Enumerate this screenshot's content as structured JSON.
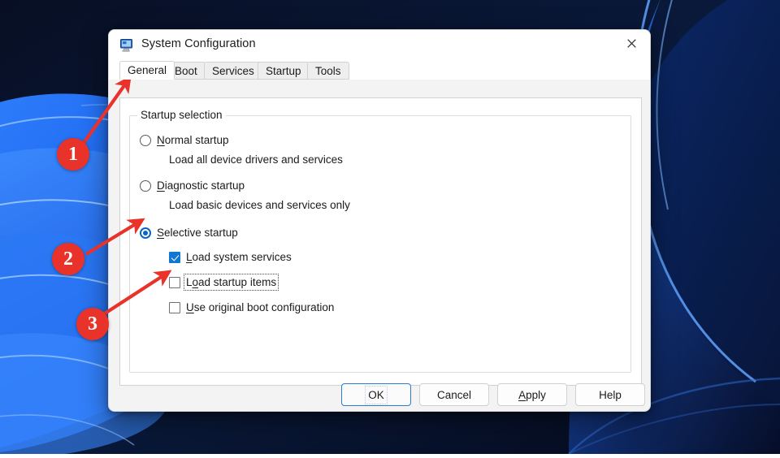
{
  "window": {
    "title": "System Configuration",
    "icon": "computer-icon",
    "close_label": "✕"
  },
  "tabs": [
    {
      "label": "General",
      "active": true
    },
    {
      "label": "Boot",
      "active": false
    },
    {
      "label": "Services",
      "active": false
    },
    {
      "label": "Startup",
      "active": false
    },
    {
      "label": "Tools",
      "active": false
    }
  ],
  "groupbox": {
    "legend": "Startup selection"
  },
  "radios": [
    {
      "label_pre": "",
      "accel": "N",
      "label_post": "ormal startup",
      "checked": false,
      "description": "Load all device drivers and services"
    },
    {
      "label_pre": "",
      "accel": "D",
      "label_post": "iagnostic startup",
      "checked": false,
      "description": "Load basic devices and services only"
    },
    {
      "label_pre": "",
      "accel": "S",
      "label_post": "elective startup",
      "checked": true,
      "description": ""
    }
  ],
  "checkboxes": [
    {
      "label_pre": "",
      "accel": "L",
      "label_post": "oad system services",
      "checked": true,
      "focused": false
    },
    {
      "label_pre": "L",
      "accel": "o",
      "label_post": "ad startup items",
      "checked": false,
      "focused": true
    },
    {
      "label_pre": "",
      "accel": "U",
      "label_post": "se original boot configuration",
      "checked": false,
      "focused": false
    }
  ],
  "buttons": [
    {
      "label_pre": "OK",
      "accel": "",
      "label_post": "",
      "default": true
    },
    {
      "label_pre": "Cancel",
      "accel": "",
      "label_post": "",
      "default": false
    },
    {
      "label_pre": "",
      "accel": "A",
      "label_post": "pply",
      "default": false
    },
    {
      "label_pre": "Help",
      "accel": "",
      "label_post": "",
      "default": false
    }
  ],
  "annotations": [
    {
      "number": "1",
      "target": "general-tab"
    },
    {
      "number": "2",
      "target": "selective-startup-radio"
    },
    {
      "number": "3",
      "target": "load-startup-items-checkbox"
    }
  ],
  "colors": {
    "accent": "#0a64c2",
    "checkbox_fill": "#1177d1",
    "annotation_red": "#e8322a",
    "default_button_border": "#2b7cd3",
    "wallpaper_dark": "#0a1630",
    "wallpaper_blue": "#1a6df0"
  }
}
